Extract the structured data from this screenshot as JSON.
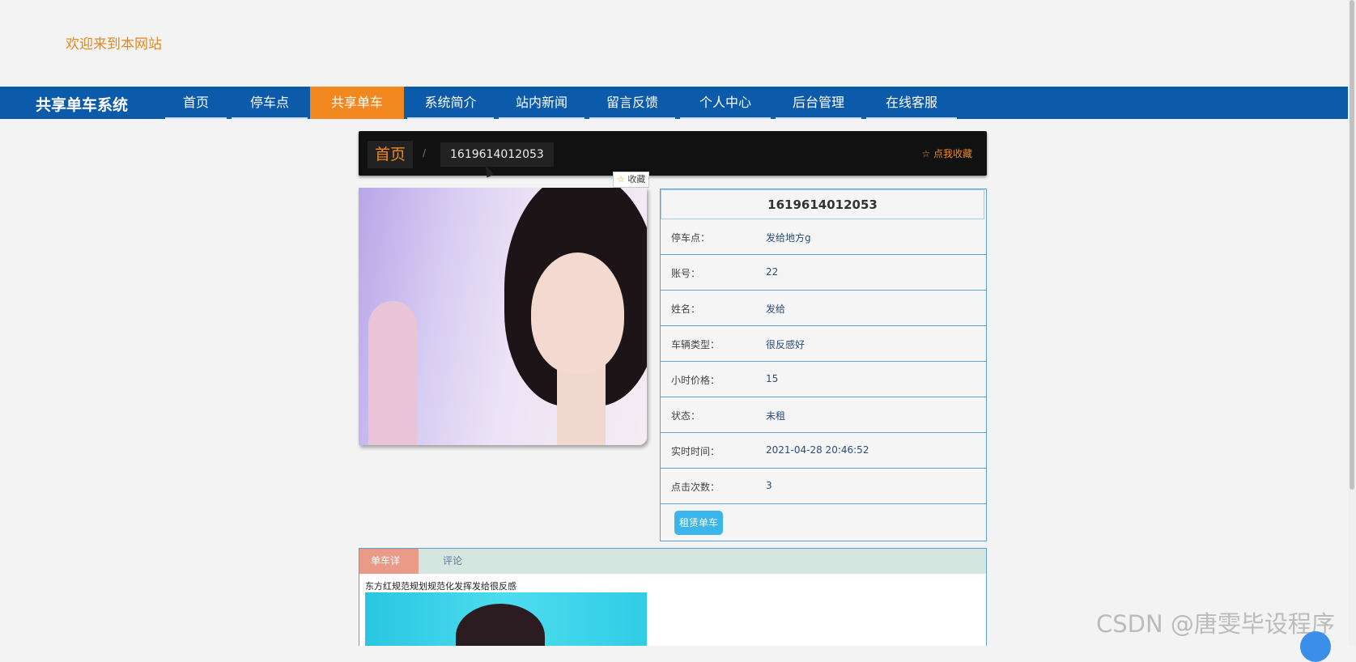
{
  "header": {
    "welcome": "欢迎来到本网站"
  },
  "nav": {
    "brand": "共享单车系统",
    "items": [
      {
        "label": "首页"
      },
      {
        "label": "停车点"
      },
      {
        "label": "共享单车"
      },
      {
        "label": "系统简介"
      },
      {
        "label": "站内新闻"
      },
      {
        "label": "留言反馈"
      },
      {
        "label": "个人中心"
      },
      {
        "label": "后台管理"
      },
      {
        "label": "在线客服"
      }
    ],
    "active": "共享单车"
  },
  "breadcrumb": {
    "home": "首页",
    "separator": "/",
    "current": "1619614012053",
    "favorite": "点我收藏"
  },
  "tooltip": {
    "star": "☆",
    "label": "收藏"
  },
  "detail": {
    "title": "1619614012053",
    "rows": [
      {
        "label": "停车点：",
        "value": "发给地方g"
      },
      {
        "label": "账号：",
        "value": "22"
      },
      {
        "label": "姓名：",
        "value": "发给"
      },
      {
        "label": "车辆类型：",
        "value": "很反感好"
      },
      {
        "label": "小时价格：",
        "value": "15"
      },
      {
        "label": "状态：",
        "value": "未租"
      },
      {
        "label": "实时时间：",
        "value": "2021-04-28 20:46:52"
      },
      {
        "label": "点击次数：",
        "value": "3"
      }
    ],
    "rent_button": "租赁单车"
  },
  "tabs": {
    "items": [
      {
        "label": "单车详情"
      },
      {
        "label": "评论"
      }
    ],
    "description": "东方红规范规划规范化发挥发给很反感"
  },
  "watermark": "CSDN @唐雯毕设程序",
  "colors": {
    "nav_bg": "#0c5aaa",
    "accent": "#f0881f",
    "button": "#3ab6ea",
    "border": "#5aa3d3"
  }
}
